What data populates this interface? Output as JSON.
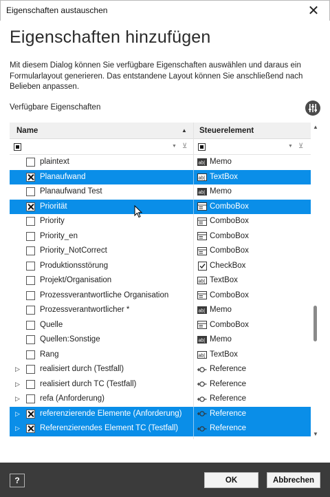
{
  "window": {
    "title": "Eigenschaften austauschen",
    "close_symbol": "✕"
  },
  "page": {
    "heading": "Eigenschaften hinzufügen",
    "description": "Mit diesem Dialog können Sie verfügbare Eigenschaften auswählen und daraus ein Formularlayout generieren. Das entstandene Layout können Sie anschließend nach Belieben anpassen.",
    "section_label": "Verfügbare Eigenschaften"
  },
  "grid": {
    "col_name": "Name",
    "col_control": "Steuerelement",
    "sort_symbol": "▲",
    "rows": [
      {
        "name": "plaintext",
        "control": "Memo",
        "icon": "memo-icon",
        "checked": false,
        "selected": false,
        "expandable": false
      },
      {
        "name": "Planaufwand",
        "control": "TextBox",
        "icon": "textbox-icon",
        "checked": true,
        "selected": true,
        "expandable": false
      },
      {
        "name": "Planaufwand Test",
        "control": "Memo",
        "icon": "memo-icon",
        "checked": false,
        "selected": false,
        "expandable": false
      },
      {
        "name": "Priorität",
        "control": "ComboBox",
        "icon": "combobox-icon",
        "checked": true,
        "selected": true,
        "expandable": false
      },
      {
        "name": "Priority",
        "control": "ComboBox",
        "icon": "combobox-icon",
        "checked": false,
        "selected": false,
        "expandable": false
      },
      {
        "name": "Priority_en",
        "control": "ComboBox",
        "icon": "combobox-icon",
        "checked": false,
        "selected": false,
        "expandable": false
      },
      {
        "name": "Priority_NotCorrect",
        "control": "ComboBox",
        "icon": "combobox-icon",
        "checked": false,
        "selected": false,
        "expandable": false
      },
      {
        "name": "Produktionsstörung",
        "control": "CheckBox",
        "icon": "checkbox-icon",
        "checked": false,
        "selected": false,
        "expandable": false
      },
      {
        "name": "Projekt/Organisation",
        "control": "TextBox",
        "icon": "textbox-icon",
        "checked": false,
        "selected": false,
        "expandable": false
      },
      {
        "name": "Prozessverantwortliche Organisation",
        "control": "ComboBox",
        "icon": "combobox-icon",
        "checked": false,
        "selected": false,
        "expandable": false
      },
      {
        "name": "Prozessverantwortlicher *",
        "control": "Memo",
        "icon": "memo-icon",
        "checked": false,
        "selected": false,
        "expandable": false
      },
      {
        "name": "Quelle",
        "control": "ComboBox",
        "icon": "combobox-icon",
        "checked": false,
        "selected": false,
        "expandable": false
      },
      {
        "name": "Quellen:Sonstige",
        "control": "Memo",
        "icon": "memo-icon",
        "checked": false,
        "selected": false,
        "expandable": false
      },
      {
        "name": "Rang",
        "control": "TextBox",
        "icon": "textbox-icon",
        "checked": false,
        "selected": false,
        "expandable": false
      },
      {
        "name": "realisiert durch (Testfall)",
        "control": "Reference",
        "icon": "reference-icon",
        "checked": false,
        "selected": false,
        "expandable": true
      },
      {
        "name": "realisiert durch TC (Testfall)",
        "control": "Reference",
        "icon": "reference-icon",
        "checked": false,
        "selected": false,
        "expandable": true
      },
      {
        "name": "refa (Anforderung)",
        "control": "Reference",
        "icon": "reference-icon",
        "checked": false,
        "selected": false,
        "expandable": true
      },
      {
        "name": "referenzierende Elemente (Anforderung)",
        "control": "Reference",
        "icon": "reference-icon",
        "checked": true,
        "selected": true,
        "expandable": true
      },
      {
        "name": "Referenzierendes Element TC (Testfall)",
        "control": "Reference",
        "icon": "reference-icon",
        "checked": true,
        "selected": true,
        "expandable": true
      }
    ]
  },
  "footer": {
    "help_label": "?",
    "ok_label": "OK",
    "cancel_label": "Abbrechen"
  },
  "colors": {
    "selection": "#0a8ee8",
    "footer": "#3b3b3b"
  }
}
